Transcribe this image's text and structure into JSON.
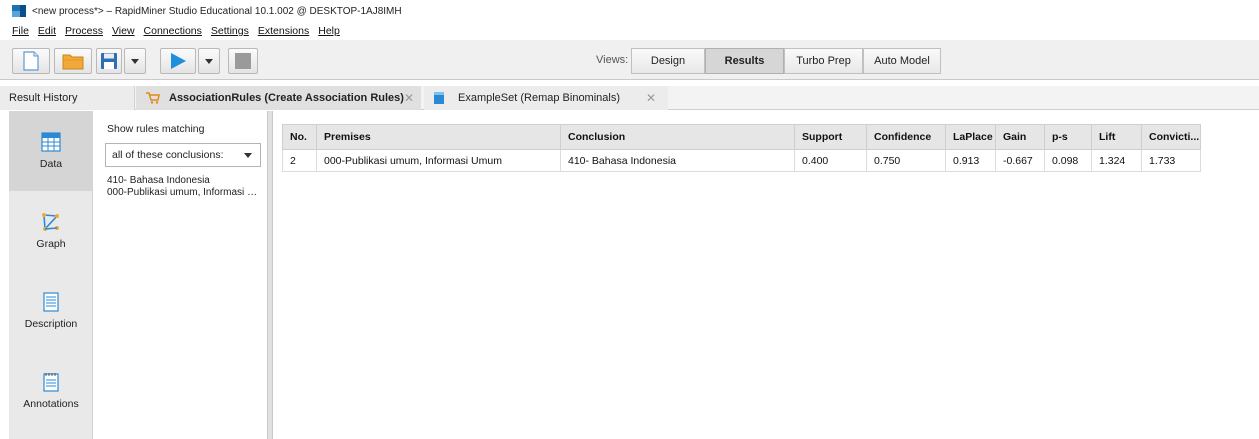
{
  "window": {
    "title": "<new process*> – RapidMiner Studio Educational 10.1.002 @ DESKTOP-1AJ8IMH"
  },
  "menu": [
    "File",
    "Edit",
    "Process",
    "View",
    "Connections",
    "Settings",
    "Extensions",
    "Help"
  ],
  "toolbar": {
    "views_label": "Views:",
    "view_tabs": [
      "Design",
      "Results",
      "Turbo Prep",
      "Auto Model"
    ],
    "active_view": "Results"
  },
  "tabs": {
    "result_history": "Result History",
    "association_rules": "AssociationRules (Create Association Rules)",
    "example_set": "ExampleSet (Remap Binominals)"
  },
  "leftnav": [
    "Data",
    "Graph",
    "Description",
    "Annotations"
  ],
  "filter": {
    "heading": "Show rules matching",
    "selected": "all of these conclusions:",
    "conclusions": [
      "410- Bahasa Indonesia",
      "000-Publikasi umum, Informasi U..."
    ]
  },
  "table": {
    "columns": [
      "No.",
      "Premises",
      "Conclusion",
      "Support",
      "Confidence",
      "LaPlace",
      "Gain",
      "p-s",
      "Lift",
      "Convicti..."
    ],
    "rows": [
      [
        "2",
        "000-Publikasi umum, Informasi Umum",
        "410- Bahasa Indonesia",
        "0.400",
        "0.750",
        "0.913",
        "-0.667",
        "0.098",
        "1.324",
        "1.733"
      ]
    ]
  },
  "colors": {
    "accent": "#1f8fdc",
    "folder": "#f2a93b"
  }
}
